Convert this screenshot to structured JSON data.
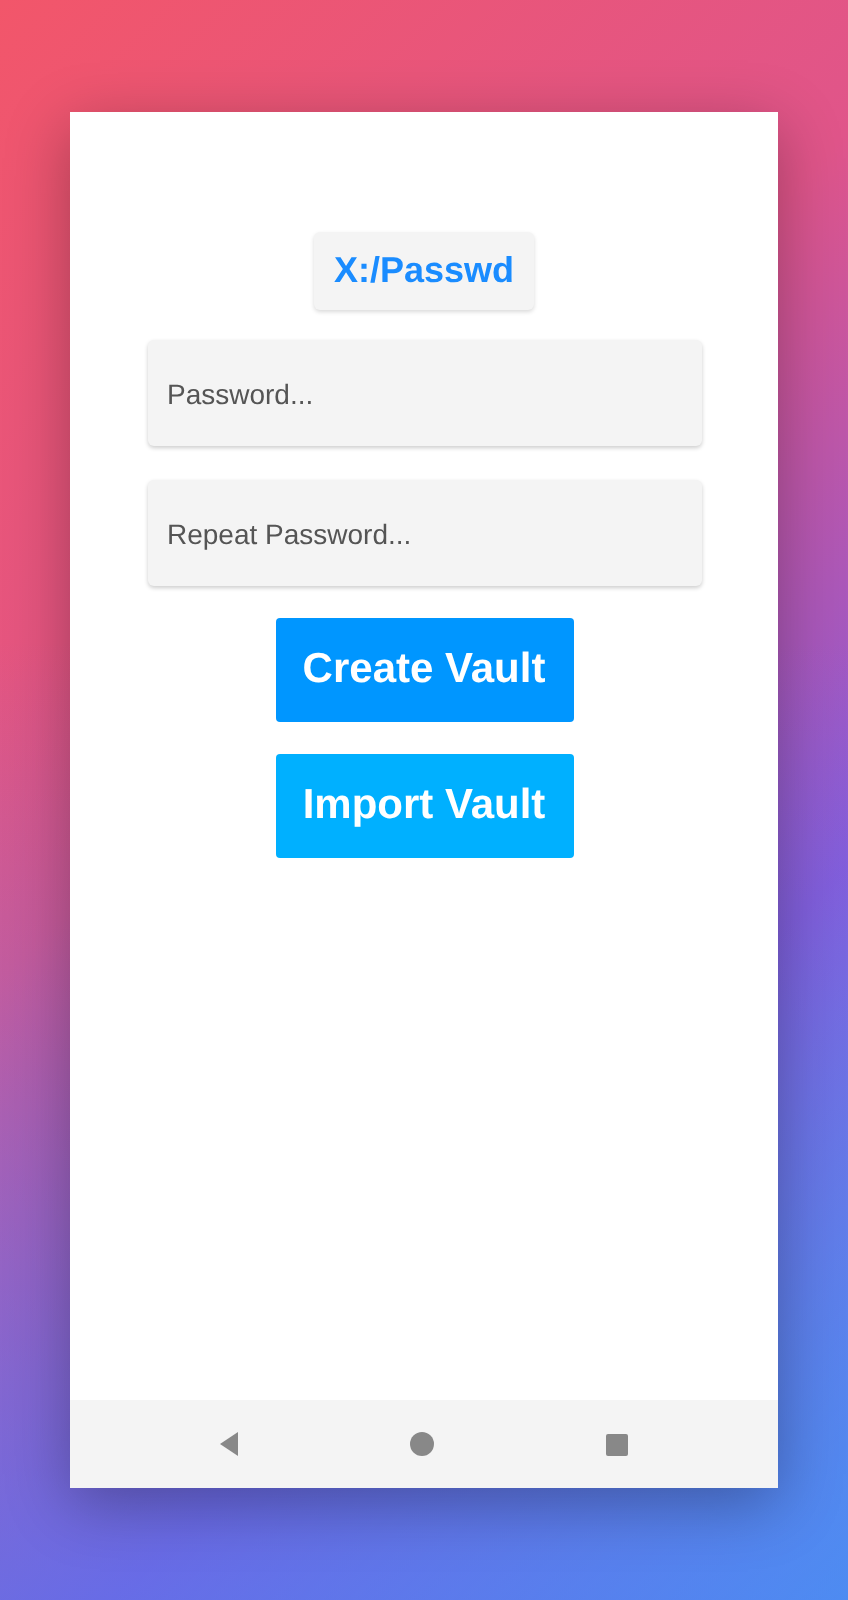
{
  "title_button": {
    "label": "X:/Passwd"
  },
  "fields": [
    {
      "placeholder": "Password..."
    },
    {
      "placeholder": "Repeat Password..."
    }
  ],
  "buttons": [
    {
      "label": "Create Vault",
      "color": "#0096ff"
    },
    {
      "label": "Import Vault",
      "color": "#00b0ff"
    }
  ],
  "nav_bar": [
    {
      "kind": "back"
    },
    {
      "kind": "home"
    },
    {
      "kind": "recents"
    }
  ]
}
